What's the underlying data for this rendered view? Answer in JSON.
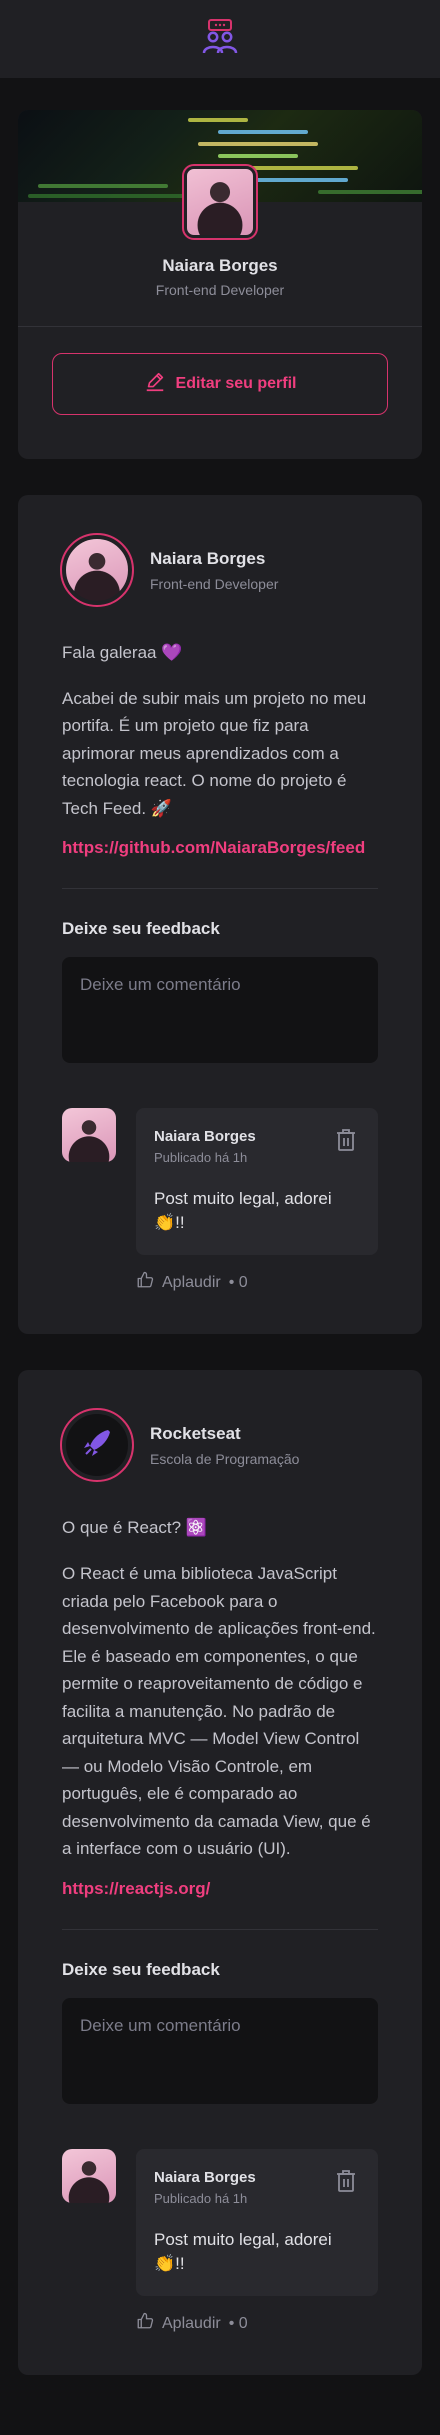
{
  "header": {
    "logo_icon": "people-icon",
    "accent": "#8257E5"
  },
  "profile": {
    "name": "Naiara Borges",
    "role": "Front-end Developer",
    "edit_label": "Editar seu perfil"
  },
  "posts": [
    {
      "author": {
        "name": "Naiara Borges",
        "role": "Front-end Developer"
      },
      "paragraphs": [
        "Fala galeraa 💜",
        "Acabei de subir mais um projeto no meu portifa. É um projeto que fiz para aprimorar meus aprendizados com a tecnologia react. O nome do projeto é Tech Feed. 🚀"
      ],
      "link": "https://github.com/NaiaraBorges/feed",
      "feedback_title": "Deixe seu feedback",
      "comment_placeholder": "Deixe um comentário",
      "comments": [
        {
          "author": "Naiara Borges",
          "time": "Publicado há 1h",
          "text": "Post muito legal, adorei 👏!!",
          "applause_label": "Aplaudir",
          "applause_count": "• 0"
        }
      ]
    },
    {
      "author": {
        "name": "Rocketseat",
        "role": "Escola de Programação"
      },
      "paragraphs": [
        "O que é React? ⚛️",
        "O React é uma biblioteca JavaScript criada pelo Facebook para o desenvolvimento de aplicações front-end. Ele é baseado em componentes, o que permite o reaproveitamento de código e facilita a manutenção. No padrão de arquitetura MVC — Model View Control — ou Modelo Visão Controle, em português, ele é comparado ao desenvolvimento da camada View, que é a interface com o usuário (UI)."
      ],
      "link": "https://reactjs.org/",
      "feedback_title": "Deixe seu feedback",
      "comment_placeholder": "Deixe um comentário",
      "comments": [
        {
          "author": "Naiara Borges",
          "time": "Publicado há 1h",
          "text": "Post muito legal, adorei 👏!!",
          "applause_label": "Aplaudir",
          "applause_count": "• 0"
        }
      ]
    }
  ],
  "colors": {
    "accent_pink": "#F03E7F",
    "border_pink": "#D6336C",
    "card": "#202024",
    "background": "#121214"
  }
}
